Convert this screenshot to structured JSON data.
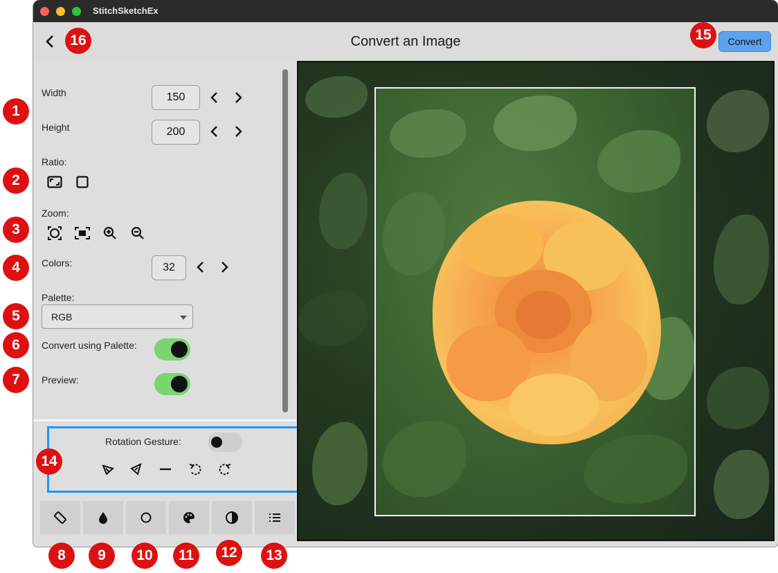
{
  "window": {
    "title": "StitchSketchEx"
  },
  "appbar": {
    "title": "Convert an Image",
    "convert_label": "Convert"
  },
  "settings": {
    "width_label": "Width",
    "width_value": "150",
    "height_label": "Height",
    "height_value": "200",
    "ratio_label": "Ratio:",
    "zoom_label": "Zoom:",
    "colors_label": "Colors:",
    "colors_value": "32",
    "palette_label": "Palette:",
    "palette_value": "RGB",
    "convert_palette_label": "Convert using Palette:",
    "convert_palette_on": true,
    "preview_label": "Preview:",
    "preview_on": true
  },
  "gesture": {
    "label": "Rotation Gesture:",
    "on": false
  },
  "tabs": [
    "rotate-device-icon",
    "drop-icon",
    "circle-icon",
    "palette-icon",
    "contrast-icon",
    "list-icon"
  ],
  "callouts": [
    "1",
    "2",
    "3",
    "4",
    "5",
    "6",
    "7",
    "8",
    "9",
    "10",
    "11",
    "12",
    "13",
    "14",
    "15",
    "16"
  ],
  "colors": {
    "accent": "#5ba3ef",
    "toggle_on": "#7ad56f",
    "highlight_box": "#2196f3",
    "callout": "#dd1111"
  }
}
